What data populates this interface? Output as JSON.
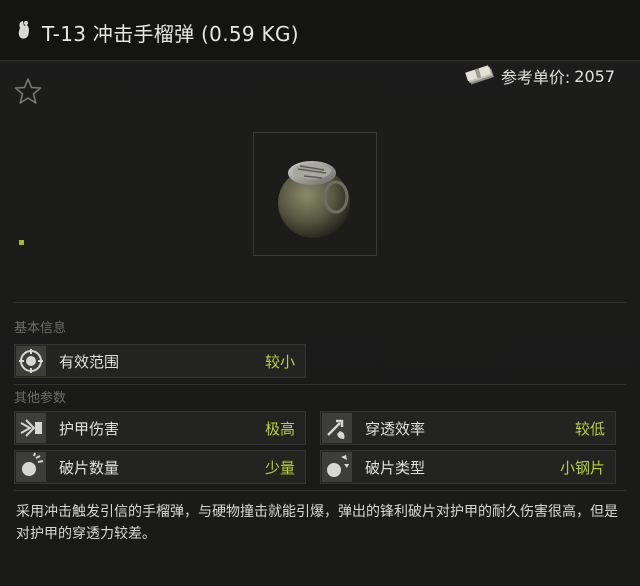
{
  "window": {
    "title": "T-13 冲击手榴弹 (0.59 KG)",
    "title_icon": "grenade-hand-icon"
  },
  "price": {
    "icon": "money-stack-icon",
    "label": "参考单价:",
    "value": "2057"
  },
  "favorite": {
    "icon": "star-outline-icon"
  },
  "sections": {
    "basic": {
      "title": "基本信息",
      "stats": [
        {
          "label": "有效范围",
          "value": "较小",
          "icon": "range-icon"
        }
      ]
    },
    "other": {
      "title": "其他参数",
      "stats": [
        {
          "label": "护甲伤害",
          "value": "极高",
          "icon": "armor-damage-icon"
        },
        {
          "label": "穿透效率",
          "value": "较低",
          "icon": "penetration-icon"
        },
        {
          "label": "破片数量",
          "value": "少量",
          "icon": "fragment-count-icon"
        },
        {
          "label": "破片类型",
          "value": "小钢片",
          "icon": "fragment-type-icon"
        }
      ]
    }
  },
  "description": "采用冲击触发引信的手榴弹，与硬物撞击就能引爆，弹出的锋利破片对护甲的耐久伤害很高，但是对护甲的穿透力较差。",
  "colors": {
    "background": "#1b1b1a",
    "stat_value": "#b7cf3a",
    "section_title": "#6c6c68"
  }
}
